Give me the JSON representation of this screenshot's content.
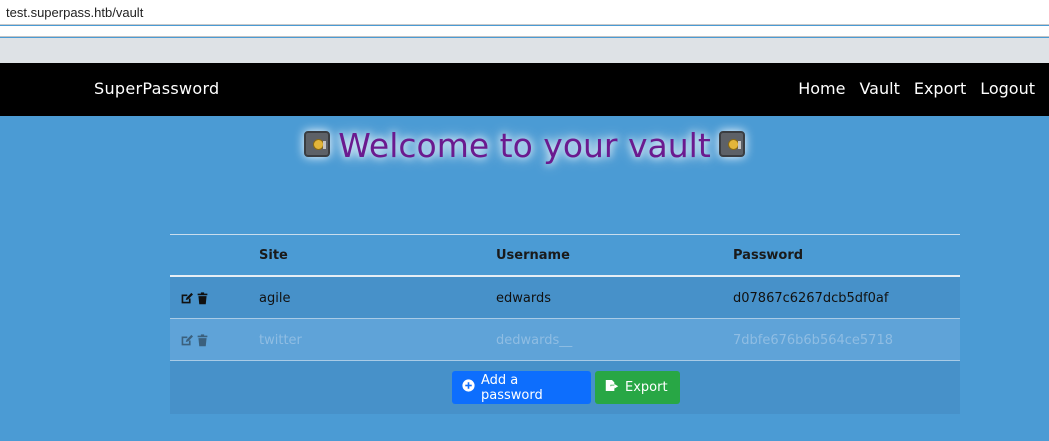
{
  "browser": {
    "url": "test.superpass.htb/vault"
  },
  "navbar": {
    "brand": "SuperPassword",
    "links": [
      "Home",
      "Vault",
      "Export",
      "Logout"
    ]
  },
  "page": {
    "title": "Welcome to your vault",
    "title_color": "#6b1a8f"
  },
  "table": {
    "headers": {
      "site": "Site",
      "username": "Username",
      "password": "Password"
    },
    "rows": [
      {
        "site": "agile",
        "username": "edwards",
        "password": "d07867c6267dcb5df0af"
      },
      {
        "site": "twitter",
        "username": "dedwards__",
        "password": "7dbfe676b6b564ce5718"
      }
    ]
  },
  "buttons": {
    "add": "Add a password",
    "export": "Export"
  },
  "icons": {
    "edit": "edit-icon",
    "delete": "trash-icon",
    "safe": "safe-icon",
    "add": "plus-circle-icon",
    "export": "export-icon"
  },
  "colors": {
    "navbar": "#000000",
    "background": "#4b9bd4",
    "add_button": "#0d6efd",
    "export_button": "#28a745"
  }
}
